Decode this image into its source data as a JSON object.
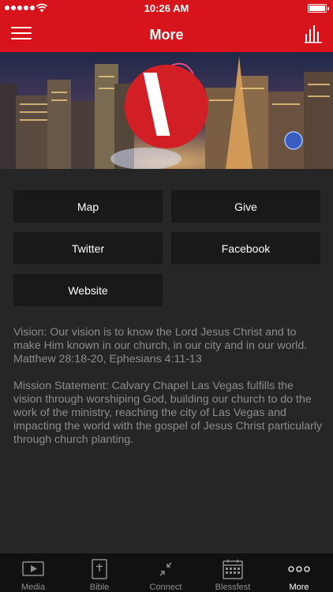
{
  "status_bar": {
    "time": "10:26 AM",
    "battery_level": 1.0
  },
  "nav": {
    "title": "More",
    "menu_icon": "hamburger-menu-icon",
    "right_icon": "bar-chart-icon"
  },
  "hero": {
    "logo_icon": "red-circle-logo"
  },
  "buttons": [
    {
      "label": "Map"
    },
    {
      "label": "Give"
    },
    {
      "label": "Twitter"
    },
    {
      "label": "Facebook"
    },
    {
      "label": "Website"
    }
  ],
  "vision_text": "Vision: Our vision is to know the Lord Jesus Christ and to make Him known in our church, in our city and in our world. Matthew 28:18-20, Ephesians 4:11-13",
  "mission_text": "Mission Statement: Calvary Chapel Las Vegas fulfills the vision through worshiping God, building our church to do the work of the ministry, reaching the city of Las Vegas and impacting the world with the gospel of Jesus Christ particularly through church planting.",
  "tabbar": {
    "tabs": [
      {
        "label": "Media",
        "icon": "play-video-icon"
      },
      {
        "label": "Bible",
        "icon": "bible-book-icon"
      },
      {
        "label": "Connect",
        "icon": "connect-arrows-icon"
      },
      {
        "label": "Blessfest",
        "icon": "calendar-icon"
      },
      {
        "label": "More",
        "icon": "more-dots-icon"
      }
    ],
    "active_index": 4
  },
  "colors": {
    "brand_red": "#d7141c",
    "background": "#262626",
    "button_bg": "#191919",
    "body_text": "#8c8c8c"
  }
}
